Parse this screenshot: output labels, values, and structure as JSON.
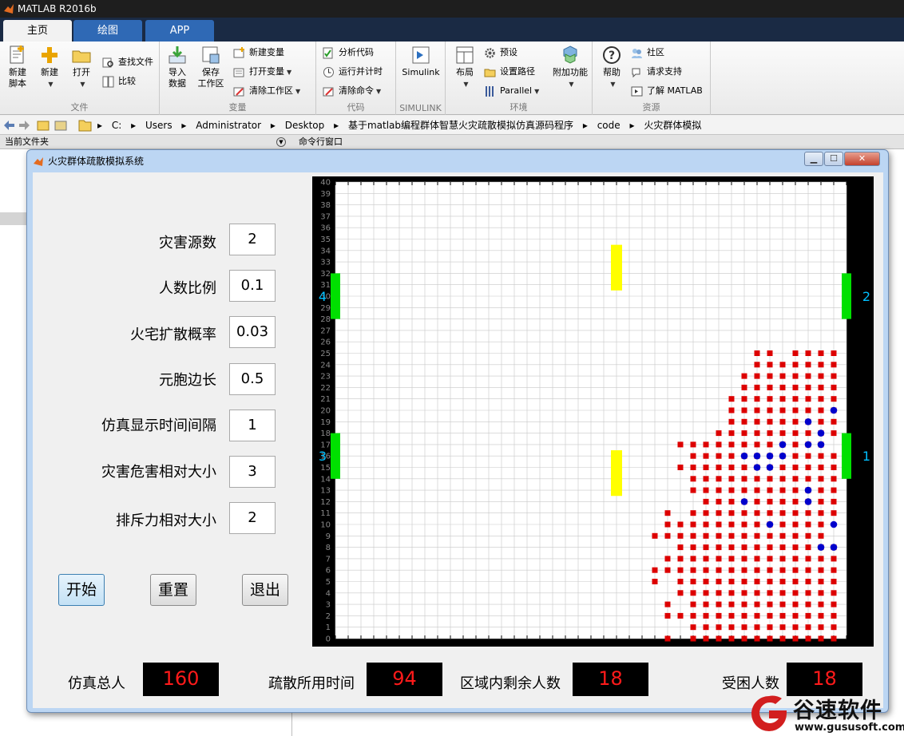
{
  "app": {
    "title": "MATLAB R2016b",
    "tabs": [
      {
        "label": "主页",
        "active": true
      },
      {
        "label": "绘图",
        "active": false
      },
      {
        "label": "APP",
        "active": false
      }
    ]
  },
  "ribbon": {
    "file": {
      "label": "文件",
      "new_script": "新建\n脚本",
      "new": "新建",
      "open": "打开",
      "find_files": "查找文件",
      "compare": "比较"
    },
    "variable": {
      "label": "变量",
      "import_data": "导入\n数据",
      "save_workspace": "保存\n工作区",
      "new_variable": "新建变量",
      "open_variable": "打开变量",
      "clear_workspace": "清除工作区"
    },
    "code": {
      "label": "代码",
      "analyze_code": "分析代码",
      "run_and_time": "运行并计时",
      "clear_commands": "清除命令"
    },
    "simulink": {
      "label": "SIMULINK",
      "simulink": "Simulink"
    },
    "environment": {
      "label": "环境",
      "layout": "布局",
      "preferences": "预设",
      "set_path": "设置路径",
      "parallel": "Parallel",
      "addons": "附加功能"
    },
    "resources": {
      "label": "资源",
      "help": "帮助",
      "community": "社区",
      "request_support": "请求支持",
      "learn_matlab": "了解 MATLAB"
    }
  },
  "address": {
    "segments": [
      "C:",
      "Users",
      "Administrator",
      "Desktop",
      "基于matlab编程群体智慧火灾疏散模拟仿真源码程序",
      "code",
      "火灾群体模拟"
    ]
  },
  "panels": {
    "current_folder": "当前文件夹",
    "command_window": "命令行窗口"
  },
  "figure": {
    "title": "火灾群体疏散模拟系统",
    "params": [
      {
        "label": "灾害源数",
        "value": "2"
      },
      {
        "label": "人数比例",
        "value": "0.1"
      },
      {
        "label": "火宅扩散概率",
        "value": "0.03"
      },
      {
        "label": "元胞边长",
        "value": "0.5"
      },
      {
        "label": "仿真显示时间间隔",
        "value": "1"
      },
      {
        "label": "灾害危害相对大小",
        "value": "3"
      },
      {
        "label": "排斥力相对大小",
        "value": "2"
      }
    ],
    "buttons": {
      "start": "开始",
      "reset": "重置",
      "exit": "退出"
    },
    "stats": [
      {
        "label": "仿真总人",
        "value": "160"
      },
      {
        "label": "疏散所用时间",
        "value": "94"
      },
      {
        "label": "区域内剩余人数",
        "value": "18"
      },
      {
        "label": "受困人数",
        "value": "18"
      }
    ]
  },
  "plot": {
    "grid_max": 40,
    "y_ticks": [
      "0",
      "1",
      "2",
      "3",
      "4",
      "5",
      "6",
      "7",
      "8",
      "9",
      "10",
      "11",
      "12",
      "13",
      "14",
      "15",
      "16",
      "17",
      "18",
      "19",
      "20",
      "21",
      "22",
      "23",
      "24",
      "25",
      "26",
      "27",
      "28",
      "29",
      "30",
      "31",
      "32",
      "33",
      "34",
      "35",
      "36",
      "37",
      "38",
      "39",
      "40"
    ],
    "exit_labels": [
      "1",
      "2",
      "3",
      "4"
    ],
    "colors": {
      "exit": "#00e000",
      "obstacle": "#ffff00",
      "fire": "#dd0000",
      "person": "#0000cc",
      "frame": "#000000",
      "exit_label": "#00bfff"
    },
    "exits": [
      {
        "label": "1",
        "side": "right",
        "y_range": [
          14,
          18
        ]
      },
      {
        "label": "2",
        "side": "right",
        "y_range": [
          28,
          32
        ]
      },
      {
        "label": "3",
        "side": "left",
        "y_range": [
          14,
          18
        ]
      },
      {
        "label": "4",
        "side": "left",
        "y_range": [
          28,
          32
        ]
      }
    ],
    "obstacles": [
      {
        "x": 22,
        "y_range": [
          12.5,
          16.5
        ]
      },
      {
        "x": 22,
        "y_range": [
          30.5,
          34.5
        ]
      }
    ],
    "fire_rows": [
      {
        "y": 0,
        "x": [
          26,
          28,
          29,
          30,
          31,
          32,
          33,
          34,
          35,
          36,
          37,
          38,
          39
        ]
      },
      {
        "y": 1,
        "x": [
          28,
          29,
          30,
          31,
          32,
          33,
          34,
          35,
          36,
          37,
          38,
          39
        ]
      },
      {
        "y": 2,
        "x": [
          26,
          27,
          28,
          29,
          30,
          31,
          32,
          33,
          34,
          35,
          36,
          37,
          38,
          39
        ]
      },
      {
        "y": 3,
        "x": [
          26,
          28,
          29,
          30,
          31,
          32,
          33,
          34,
          35,
          36,
          37,
          38,
          39
        ]
      },
      {
        "y": 4,
        "x": [
          27,
          28,
          29,
          30,
          31,
          32,
          33,
          34,
          35,
          36,
          37,
          38,
          39
        ]
      },
      {
        "y": 5,
        "x": [
          25,
          27,
          28,
          29,
          30,
          31,
          32,
          33,
          34,
          35,
          36,
          37,
          38,
          39
        ]
      },
      {
        "y": 6,
        "x": [
          25,
          26,
          27,
          28,
          29,
          30,
          31,
          32,
          33,
          34,
          35,
          36,
          37,
          38,
          39
        ]
      },
      {
        "y": 7,
        "x": [
          26,
          27,
          28,
          29,
          30,
          31,
          32,
          33,
          34,
          35,
          36,
          37,
          38,
          39
        ]
      },
      {
        "y": 8,
        "x": [
          27,
          28,
          29,
          30,
          31,
          32,
          33,
          34,
          35,
          36,
          37,
          38,
          39
        ]
      },
      {
        "y": 9,
        "x": [
          25,
          26,
          27,
          28,
          29,
          30,
          31,
          32,
          33,
          34,
          35,
          36,
          37,
          38
        ]
      },
      {
        "y": 10,
        "x": [
          26,
          27,
          28,
          29,
          30,
          31,
          32,
          33,
          34,
          35,
          36,
          37,
          38
        ]
      },
      {
        "y": 11,
        "x": [
          26,
          28,
          29,
          30,
          31,
          32,
          33,
          34,
          35,
          36,
          37,
          38,
          39
        ]
      },
      {
        "y": 12,
        "x": [
          29,
          30,
          31,
          32,
          33,
          34,
          35,
          36,
          37,
          38,
          39
        ]
      },
      {
        "y": 13,
        "x": [
          28,
          29,
          30,
          31,
          32,
          33,
          34,
          35,
          36,
          37,
          38,
          39
        ]
      },
      {
        "y": 14,
        "x": [
          28,
          29,
          30,
          31,
          32,
          33,
          34,
          35,
          36,
          37,
          38,
          39
        ]
      },
      {
        "y": 15,
        "x": [
          27,
          28,
          29,
          30,
          31,
          32,
          33,
          34,
          35,
          36,
          37,
          38,
          39
        ]
      },
      {
        "y": 16,
        "x": [
          28,
          29,
          30,
          31,
          32,
          33,
          34,
          35,
          36,
          37,
          38,
          39
        ]
      },
      {
        "y": 17,
        "x": [
          27,
          28,
          29,
          30,
          31,
          32,
          33,
          34,
          35,
          36,
          37,
          38
        ]
      },
      {
        "y": 18,
        "x": [
          30,
          31,
          32,
          33,
          34,
          35,
          36,
          37,
          38,
          39
        ]
      },
      {
        "y": 19,
        "x": [
          31,
          32,
          33,
          34,
          35,
          36,
          37,
          38,
          39
        ]
      },
      {
        "y": 20,
        "x": [
          31,
          32,
          33,
          34,
          35,
          36,
          37,
          38,
          39
        ]
      },
      {
        "y": 21,
        "x": [
          31,
          32,
          33,
          34,
          35,
          36,
          37,
          38,
          39
        ]
      },
      {
        "y": 22,
        "x": [
          32,
          33,
          34,
          35,
          36,
          37,
          38,
          39
        ]
      },
      {
        "y": 23,
        "x": [
          32,
          33,
          34,
          35,
          36,
          37,
          38,
          39
        ]
      },
      {
        "y": 24,
        "x": [
          33,
          34,
          35,
          36,
          37,
          38,
          39
        ]
      },
      {
        "y": 25,
        "x": [
          33,
          34,
          36,
          37,
          38,
          39
        ]
      }
    ],
    "people": [
      [
        39,
        20
      ],
      [
        37,
        19
      ],
      [
        38,
        18
      ],
      [
        35,
        17
      ],
      [
        37,
        17
      ],
      [
        38,
        17
      ],
      [
        32,
        16
      ],
      [
        33,
        16
      ],
      [
        34,
        16
      ],
      [
        35,
        16
      ],
      [
        33,
        15
      ],
      [
        34,
        15
      ],
      [
        37,
        13
      ],
      [
        32,
        12
      ],
      [
        37,
        12
      ],
      [
        34,
        10
      ],
      [
        39,
        10
      ],
      [
        38,
        8
      ],
      [
        39,
        8
      ]
    ]
  },
  "watermark": {
    "name": "谷速软件",
    "url": "www.gususoft.com"
  }
}
